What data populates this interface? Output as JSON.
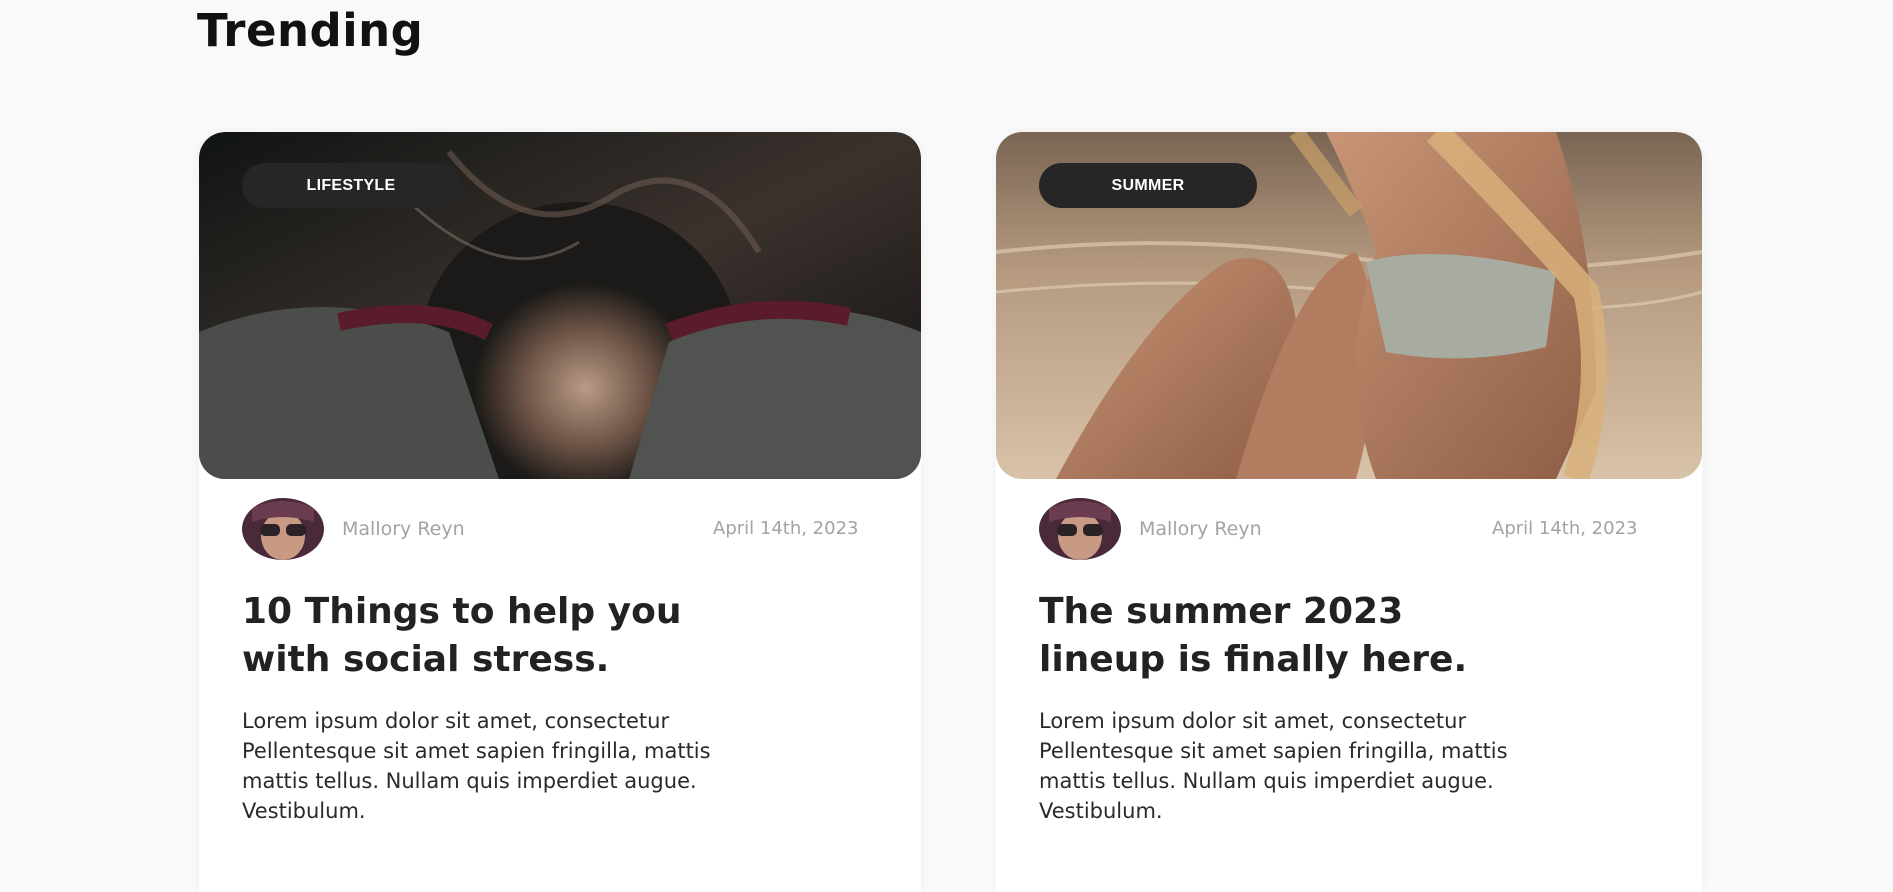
{
  "section": {
    "title": "Trending"
  },
  "cards": [
    {
      "tag": "LIFESTYLE",
      "author": "Mallory Reyn",
      "date": "April 14th, 2023",
      "headline": "10 Things to help you with social stress.",
      "excerpt": "Lorem ipsum dolor sit amet, consectetur Pellentesque sit amet sapien fringilla, mattis mattis tellus. Nullam quis imperdiet augue. Vestibulum."
    },
    {
      "tag": "SUMMER",
      "author": "Mallory Reyn",
      "date": "April 14th, 2023",
      "headline": "The summer 2023 lineup is finally here.",
      "excerpt": "Lorem ipsum dolor sit amet, consectetur Pellentesque sit amet sapien fringilla, mattis mattis tellus. Nullam quis imperdiet augue. Vestibulum."
    }
  ],
  "colors": {
    "background": "#f9f9f9",
    "tag_bg": "#262626",
    "muted_text": "#a3a3a3",
    "heading": "#222222"
  }
}
